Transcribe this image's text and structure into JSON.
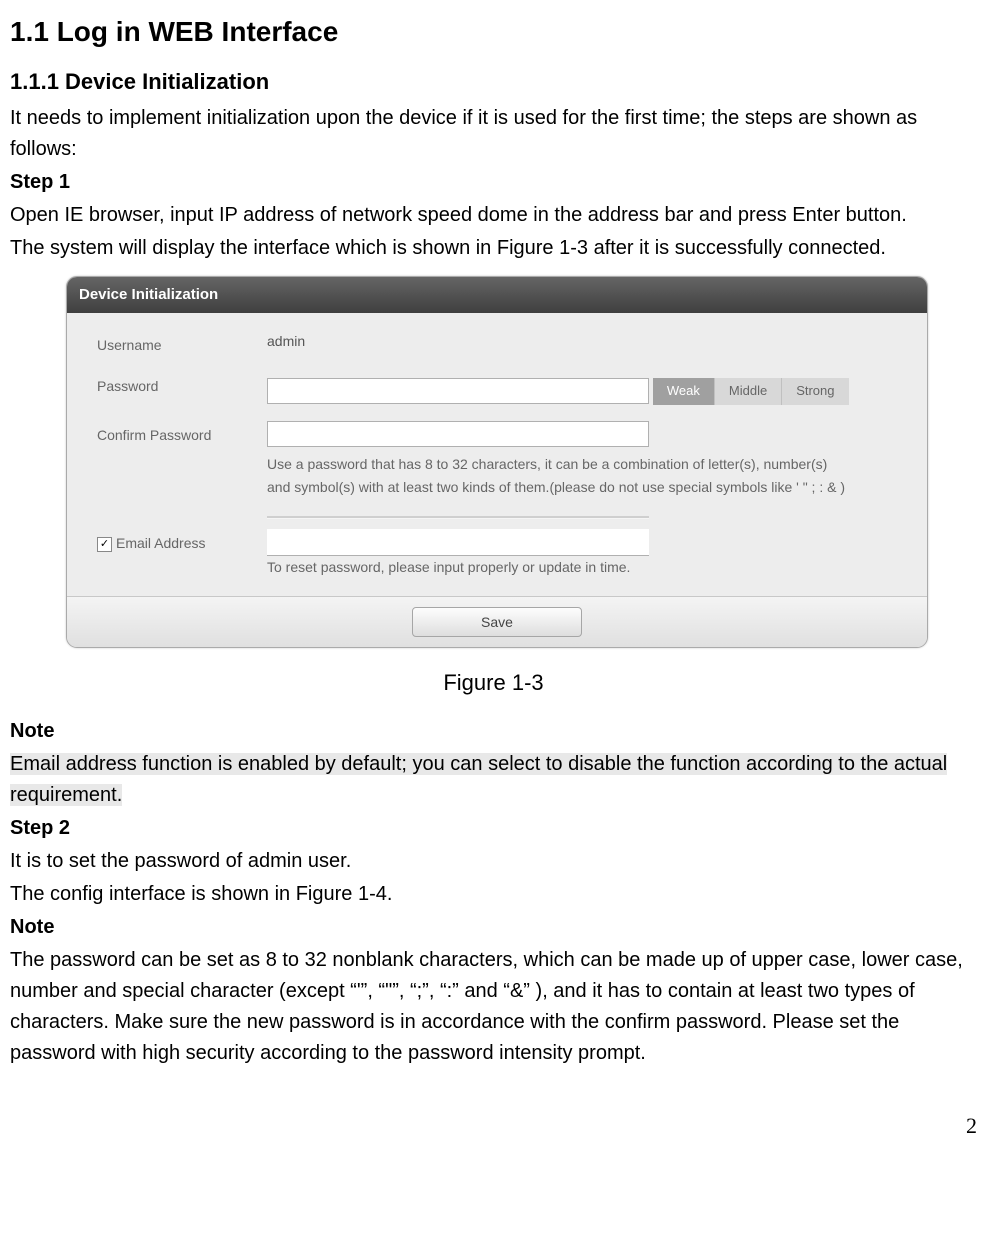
{
  "headings": {
    "section": "1.1  Log in WEB Interface",
    "subsection": "1.1.1   Device Initialization"
  },
  "intro": "It needs to implement initialization upon the device if it is used for the first time; the steps are shown as follows:",
  "step1_label": "Step 1",
  "step1_body1": "Open IE browser, input IP address of network speed dome in the address bar and press Enter button.",
  "step1_body2": "The system will display the interface which is shown in Figure 1-3 after it is successfully connected.",
  "dialog": {
    "title": "Device Initialization",
    "username_label": "Username",
    "username_value": "admin",
    "password_label": "Password",
    "strength": {
      "weak": "Weak",
      "middle": "Middle",
      "strong": "Strong"
    },
    "confirm_label": "Confirm Password",
    "pw_hint": "Use a password that has 8 to 32 characters, it can be a combination of letter(s), number(s) and symbol(s) with at least two kinds of them.(please do not use special symbols like ' \" ; : & )",
    "email_label": "Email Address",
    "email_hint": "To reset password, please input properly or update in time.",
    "save": "Save"
  },
  "figure_caption": "Figure 1-3",
  "note1_label": "Note",
  "note1_body": "Email address function is enabled by default; you can select to disable the function according to the actual requirement.",
  "step2_label": "Step 2",
  "step2_body1": "It is to set the password of admin user.",
  "step2_body2": "The config interface is shown in Figure 1-4.",
  "note2_label": "Note",
  "note2_body": "The password can be set as 8 to 32 nonblank characters, which can be made up of upper case, lower case, number and special character (except “'”, “\"”, “;”, “:” and “&” ), and it has to contain at least two types of characters. Make sure the new password is in accordance with the confirm password. Please set the password with high security according to the password intensity prompt.",
  "page_number": "2"
}
